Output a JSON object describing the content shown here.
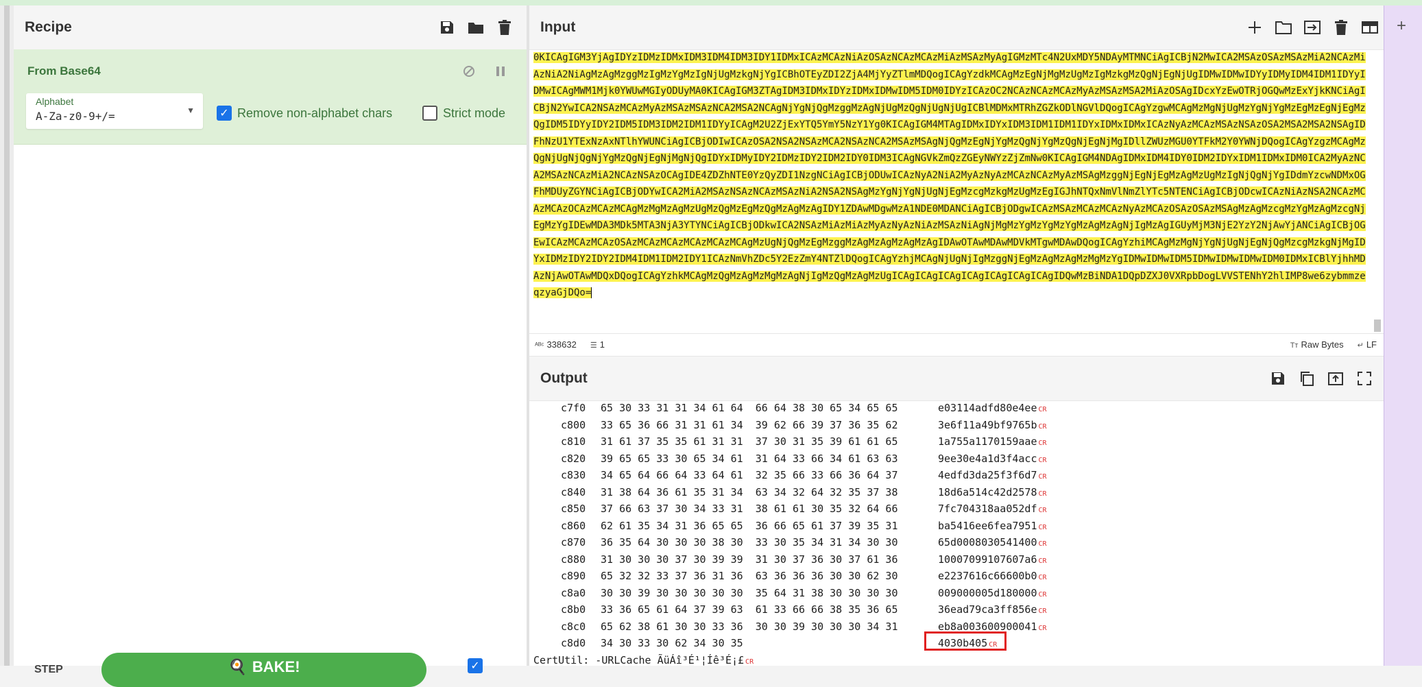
{
  "recipe": {
    "title": "Recipe",
    "operation": {
      "name": "From Base64",
      "alphabet_label": "Alphabet",
      "alphabet_value": "A-Za-z0-9+/=",
      "remove_non_alphabet_label": "Remove non-alphabet chars",
      "remove_non_alphabet_checked": true,
      "strict_mode_label": "Strict mode",
      "strict_mode_checked": false
    },
    "step_label": "STEP",
    "bake_label": "BAKE!",
    "auto_bake_checked": true
  },
  "input": {
    "title": "Input",
    "text": "0KICAgIGM3YjAgIDYzIDMzIDMxIDM3IDM4IDM3IDY1IDMxICAzMCAzNiAzOSAzNCAzMCAzMiAzMSAzMyAgIGMzMTc4N2UxMDY5NDAyMTMNCiAgICBjN2MwICA2MSAzOSAzMSAzMiA2NCAzMiAzNiA2NiAgMzAgMzggMzIgMzYgMzIgNjUgMzkgNjYgICBhOTEyZDI2ZjA4MjYyZTlmMDQogICAgYzdkMCAgMzEgNjMgMzUgMzIgMzkgMzQgNjEgNjUgIDMwIDMwIDYyIDMyIDM4IDM1IDYyIDMwICAgMWM1Mjk0YWUwMGIyODUyMA0KICAgIGM3ZTAgIDM3IDMxIDYzIDMxIDMwIDM5IDM0IDYzICAzOC2NCAzNCAzMCAzMyAzMSAzMSA2MiAzOSAgIDcxYzEwOTRjOGQwMzExYjkKNCiAgICBjN2YwICA2NSAzMCAzMyAzMSAzMSAzNCA2MSA2NCAgNjYgNjQgMzggMzAgNjUgMzQgNjUgNjUgICBlMDMxMTRhZGZkODlNGVlDQogICAgYzgwMCAgMzMgNjUgMzYgNjYgMzEgMzEgNjEgMzQgIDM5IDYyIDY2IDM5IDM3IDM2IDM1IDYyICAgM2U2ZjExYTQ5YmY5NzY1Yg0KICAgIGM4MTAgIDMxIDYxIDM3IDM1IDM1IDYxIDMxIDMxICAzNyAzMCAzMSAzNSAzOSA2MSA2MSA2NSAgIDFhNzU1YTExNzAxNTlhYWUNCiAgICBjODIwICAzOSA2NSA2NSAzMCA2NSAzNCA2MSAzMSAgNjQgMzEgNjYgMzQgNjYgMzQgNjEgNjMgIDllZWUzMGU0YTFkM2Y0YWNjDQogICAgYzgzMCAgMzQgNjUgNjQgNjYgMzQgNjEgNjMgNjQgIDYxIDMyIDY2IDMzIDY2IDM2IDY0IDM3ICAgNGVkZmQzZGEyNWYzZjZmNw0KICAgIGM4NDAgIDMxIDM4IDY0IDM2IDYxIDM1IDMxIDM0ICA2MyAzNCA2MSAzNCAzMiA2NCAzNSAzOCAgIDE4ZDZhNTE0YzQyZDI1NzgNCiAgICBjODUwICAzNyA2NiA2MyAzNyAzMCAzNCAzMyAzMSAgMzggNjEgNjEgMzAgMzUgMzIgNjQgNjYgIDdmYzcwNDMxOGFhMDUyZGYNCiAgICBjODYwICA2MiA2MSAzNSAzNCAzMSAzNiA2NSA2NSAgMzYgNjYgNjUgNjEgMzcgMzkgMzUgMzEgIGJhNTQxNmVlNmZlYTc5NTENCiAgICBjODcwICAzNiAzNSA2NCAzMCAzMCAzOCAzMCAzMCAgMzMgMzAgMzUgMzQgMzEgMzQgMzAgMzAgIDY1ZDAwMDgwMzA1NDE0MDANCiAgICBjODgwICAzMSAzMCAzMCAzNyAzMCAzOSAzOSAzMSAgMzAgMzcgMzYgMzAgMzcgNjEgMzYgIDEwMDA3MDk5MTA3NjA3YTYNCiAgICBjODkwICA2NSAzMiAzMiAzMyAzNyAzNiAzMSAzNiAgNjMgMzYgMzYgMzYgMzAgMzAgNjIgMzAgIGUyMjM3NjE2YzY2NjAwYjANCiAgICBjOGEwICAzMCAzMCAzOSAzMCAzMCAzMCAzMCAzMCAgMzUgNjQgMzEgMzggMzAgMzAgMzAgMzAgIDAwOTAwMDAwMDVkMTgwMDAwDQogICAgYzhiMCAgMzMgNjYgNjUgNjEgNjQgMzcgMzkgNjMgIDYxIDMzIDY2IDY2IDM4IDM1IDM2IDY1ICAzNmVhZDc5Y2EzZmY4NTZlDQogICAgYzhjMCAgNjUgNjIgMzggNjEgMzAgMzAgMzMgMzYgIDMwIDMwIDM5IDMwIDMwIDMwIDM0IDMxICBlYjhhMDAzNjAwOTAwMDQxDQogICAgYzhkMCAgMzQgMzAgMzMgMzAgNjIgMzQgMzAgMzUgICAgICAgICAgICAgICAgICAgICAgIDQwMzBiNDA1DQpDZXJ0VXRpbDogLVVSTENhY2hlIMP8we6zybmmze qzyaGjDQo=",
    "status_length": "338632",
    "status_lines": "1",
    "raw_bytes_label": "Raw Bytes",
    "eol_label": "LF"
  },
  "output": {
    "title": "Output",
    "rows": [
      {
        "offset": "c7f0",
        "hex": "65 30 33 31 31 34 61 64  66 64 38 30 65 34 65 65",
        "text": "e03114adfd80e4ee"
      },
      {
        "offset": "c800",
        "hex": "33 65 36 66 31 31 61 34  39 62 66 39 37 36 35 62",
        "text": "3e6f11a49bf9765b"
      },
      {
        "offset": "c810",
        "hex": "31 61 37 35 35 61 31 31  37 30 31 35 39 61 61 65",
        "text": "1a755a1170159aae"
      },
      {
        "offset": "c820",
        "hex": "39 65 65 33 30 65 34 61  31 64 33 66 34 61 63 63",
        "text": "9ee30e4a1d3f4acc"
      },
      {
        "offset": "c830",
        "hex": "34 65 64 66 64 33 64 61  32 35 66 33 66 36 64 37",
        "text": "4edfd3da25f3f6d7"
      },
      {
        "offset": "c840",
        "hex": "31 38 64 36 61 35 31 34  63 34 32 64 32 35 37 38",
        "text": "18d6a514c42d2578"
      },
      {
        "offset": "c850",
        "hex": "37 66 63 37 30 34 33 31  38 61 61 30 35 32 64 66",
        "text": "7fc704318aa052df"
      },
      {
        "offset": "c860",
        "hex": "62 61 35 34 31 36 65 65  36 66 65 61 37 39 35 31",
        "text": "ba5416ee6fea7951"
      },
      {
        "offset": "c870",
        "hex": "36 35 64 30 30 30 38 30  33 30 35 34 31 34 30 30",
        "text": "65d0008030541400"
      },
      {
        "offset": "c880",
        "hex": "31 30 30 30 37 30 39 39  31 30 37 36 30 37 61 36",
        "text": "10007099107607a6"
      },
      {
        "offset": "c890",
        "hex": "65 32 32 33 37 36 31 36  63 36 36 36 30 30 62 30",
        "text": "e2237616c66600b0"
      },
      {
        "offset": "c8a0",
        "hex": "30 30 39 30 30 30 30 30  35 64 31 38 30 30 30 30",
        "text": "009000005d180000"
      },
      {
        "offset": "c8b0",
        "hex": "33 36 65 61 64 37 39 63  61 33 66 66 38 35 36 65",
        "text": "36ead79ca3ff856e"
      },
      {
        "offset": "c8c0",
        "hex": "65 62 38 61 30 30 33 36  30 30 39 30 30 30 34 31",
        "text": "eb8a003600900041"
      },
      {
        "offset": "c8d0",
        "hex": "34 30 33 30 62 34 30 35",
        "text": "4030b405"
      }
    ],
    "last_line": "CertUtil: -URLCache ÃüÁî³É¹¦Íê³É¡£",
    "cr_marker": "CR"
  }
}
